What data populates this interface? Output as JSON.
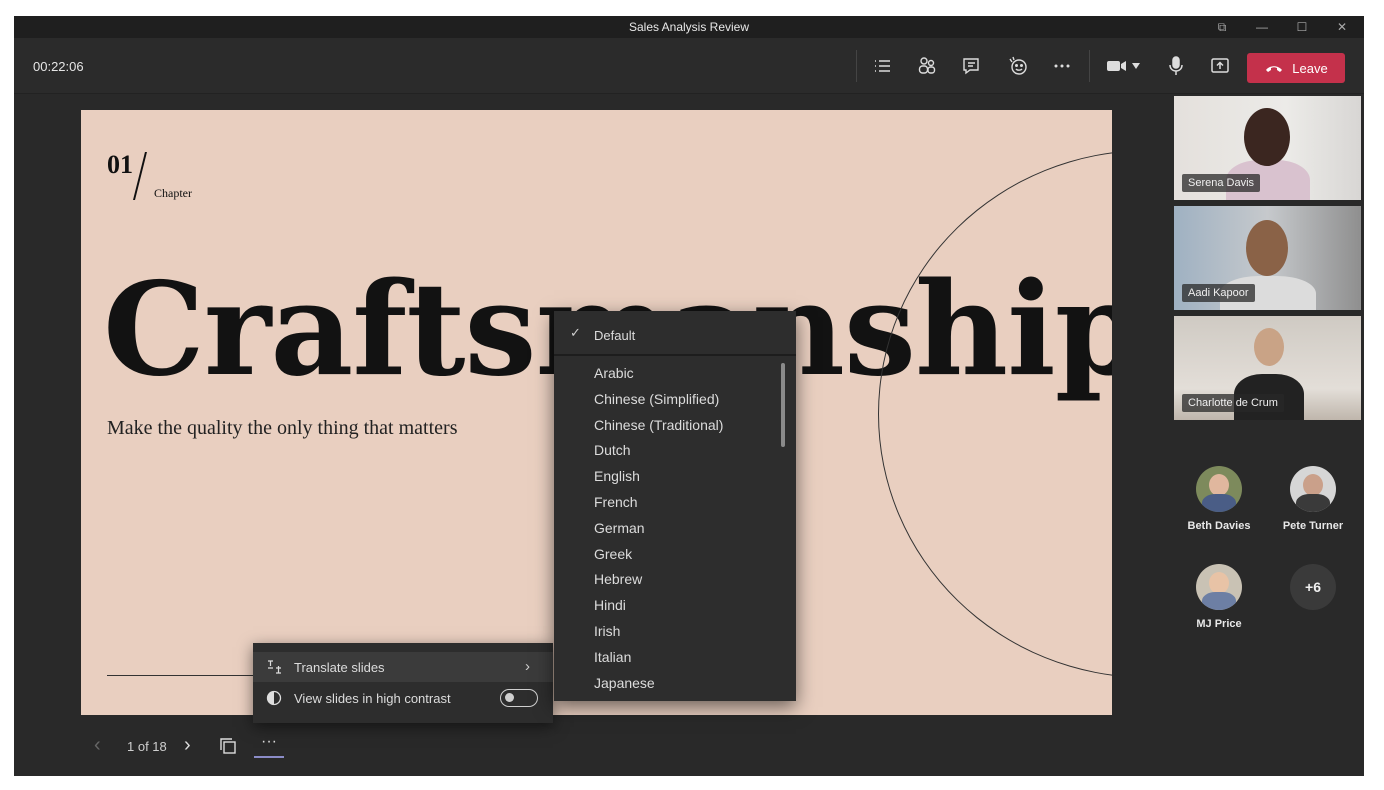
{
  "window": {
    "title": "Sales Analysis Review"
  },
  "toolbar": {
    "timer": "00:22:06",
    "leave_label": "Leave",
    "icons": [
      "list-icon",
      "people-icon",
      "chat-icon",
      "reactions-icon",
      "more-icon",
      "camera-icon",
      "mic-icon",
      "share-icon"
    ]
  },
  "slide": {
    "chapter_number": "01",
    "chapter_label": "Chapter",
    "title": "Craftsmanship.",
    "subtitle": "Make the quality the only thing that matters"
  },
  "slide_nav": {
    "counter": "1 of 18",
    "more": "···"
  },
  "context_menu": {
    "translate_label": "Translate slides",
    "high_contrast_label": "View slides in high contrast",
    "high_contrast_on": false
  },
  "language_menu": {
    "default_label": "Default",
    "languages": [
      "Arabic",
      "Chinese (Simplified)",
      "Chinese (Traditional)",
      "Dutch",
      "English",
      "French",
      "German",
      "Greek",
      "Hebrew",
      "Hindi",
      "Irish",
      "Italian",
      "Japanese"
    ]
  },
  "participants": {
    "video": [
      {
        "name": "Serena Davis"
      },
      {
        "name": "Aadi Kapoor"
      },
      {
        "name": "Charlotte de Crum"
      }
    ],
    "avatars": [
      {
        "name": "Beth Davies"
      },
      {
        "name": "Pete Turner"
      },
      {
        "name": "MJ Price"
      }
    ],
    "overflow_count": "+6"
  },
  "colors": {
    "leave": "#c4314b",
    "slide_bg": "#e9cfc0",
    "accent": "#8b8cc7"
  }
}
